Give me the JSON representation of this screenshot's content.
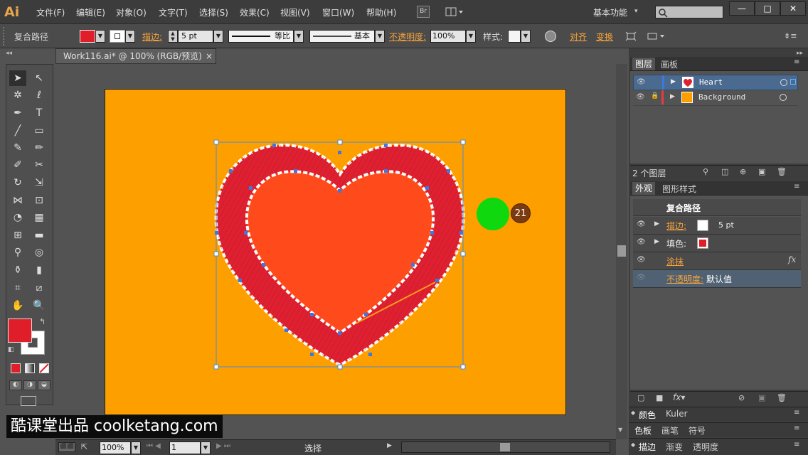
{
  "app": {
    "logo": "Ai"
  },
  "menu": [
    "文件(F)",
    "编辑(E)",
    "对象(O)",
    "文字(T)",
    "选择(S)",
    "效果(C)",
    "视图(V)",
    "窗口(W)",
    "帮助(H)"
  ],
  "bridge_label": "Br",
  "workspace": "基本功能",
  "window_buttons": [
    "—",
    "□",
    "✕"
  ],
  "control": {
    "object_type": "复合路径",
    "stroke_label": "描边:",
    "stroke_value": "5 pt",
    "profile_label": "等比",
    "brush_label": "基本",
    "opacity_label": "不透明度:",
    "opacity_value": "100%",
    "style_label": "样式:",
    "align_label": "对齐",
    "transform_label": "变换"
  },
  "document": {
    "tab_title": "Work116.ai* @ 100% (RGB/预览)",
    "close": "×"
  },
  "layers_panel": {
    "tabs": [
      "图层",
      "画板"
    ],
    "layers": [
      {
        "name": "Heart"
      },
      {
        "name": "Background"
      }
    ],
    "footer": "2 个图层"
  },
  "appearance_panel": {
    "tabs": [
      "外观",
      "图形样式"
    ],
    "title": "复合路径",
    "rows": [
      {
        "label": "描边:",
        "value": "5 pt"
      },
      {
        "label": "填色:",
        "value": ""
      },
      {
        "label": "涂抹",
        "value": "fx"
      },
      {
        "label": "不透明度:",
        "value": "默认值"
      }
    ]
  },
  "bottom_panels": [
    {
      "tabs": [
        "颜色",
        "Kuler"
      ]
    },
    {
      "tabs": [
        "色板",
        "画笔",
        "符号"
      ]
    },
    {
      "tabs": [
        "描边",
        "渐变",
        "透明度"
      ]
    }
  ],
  "status": {
    "zoom": "100%",
    "page": "1",
    "tool": "选择"
  },
  "overlay": {
    "badge": "21",
    "watermark": "酷课堂出品 coolketang.com"
  },
  "colors": {
    "artboard": "#fe9f00",
    "heart_outer": "#de2030",
    "heart_inner": "#ff4a1c",
    "fill_swatch": "#e01e2a",
    "click_marker": "#0fd80f"
  }
}
